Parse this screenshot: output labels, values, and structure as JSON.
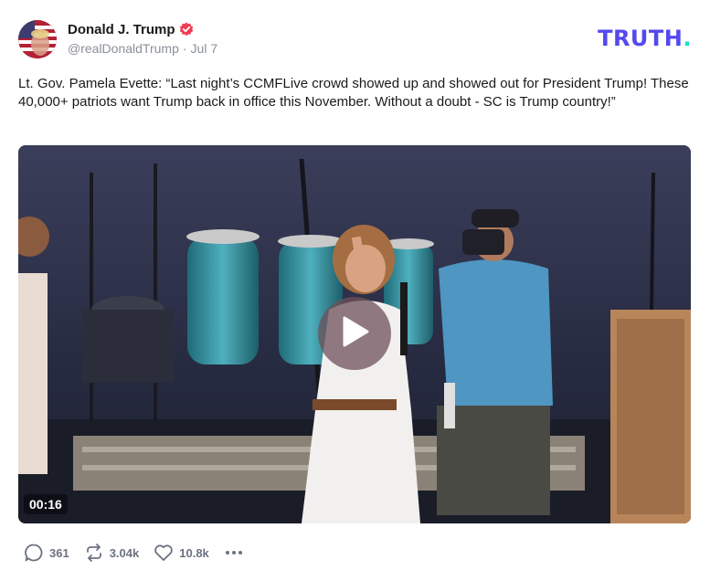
{
  "post": {
    "author_name": "Donald J. Trump",
    "handle": "@realDonaldTrump",
    "separator": "·",
    "date": "Jul 7",
    "text": "Lt. Gov. Pamela Evette: “Last night’s CCMFLive crowd showed up and showed out for President Trump! These 40,000+ patriots want Trump back in office this November. Without a doubt - SC is Trump country!”"
  },
  "brand": {
    "logo_text": "TRUTH",
    "logo_dot": ".",
    "color": "#5448EE",
    "dot_color": "#17E0C4"
  },
  "media": {
    "duration": "00:16",
    "play_icon": "play-icon"
  },
  "actions": {
    "replies": "361",
    "retruths": "3.04k",
    "likes": "10.8k",
    "more_icon": "more-dots-icon"
  },
  "colors": {
    "verified": "#F03E55",
    "meta_text": "#8A8F98",
    "action_text": "#6B7280"
  }
}
